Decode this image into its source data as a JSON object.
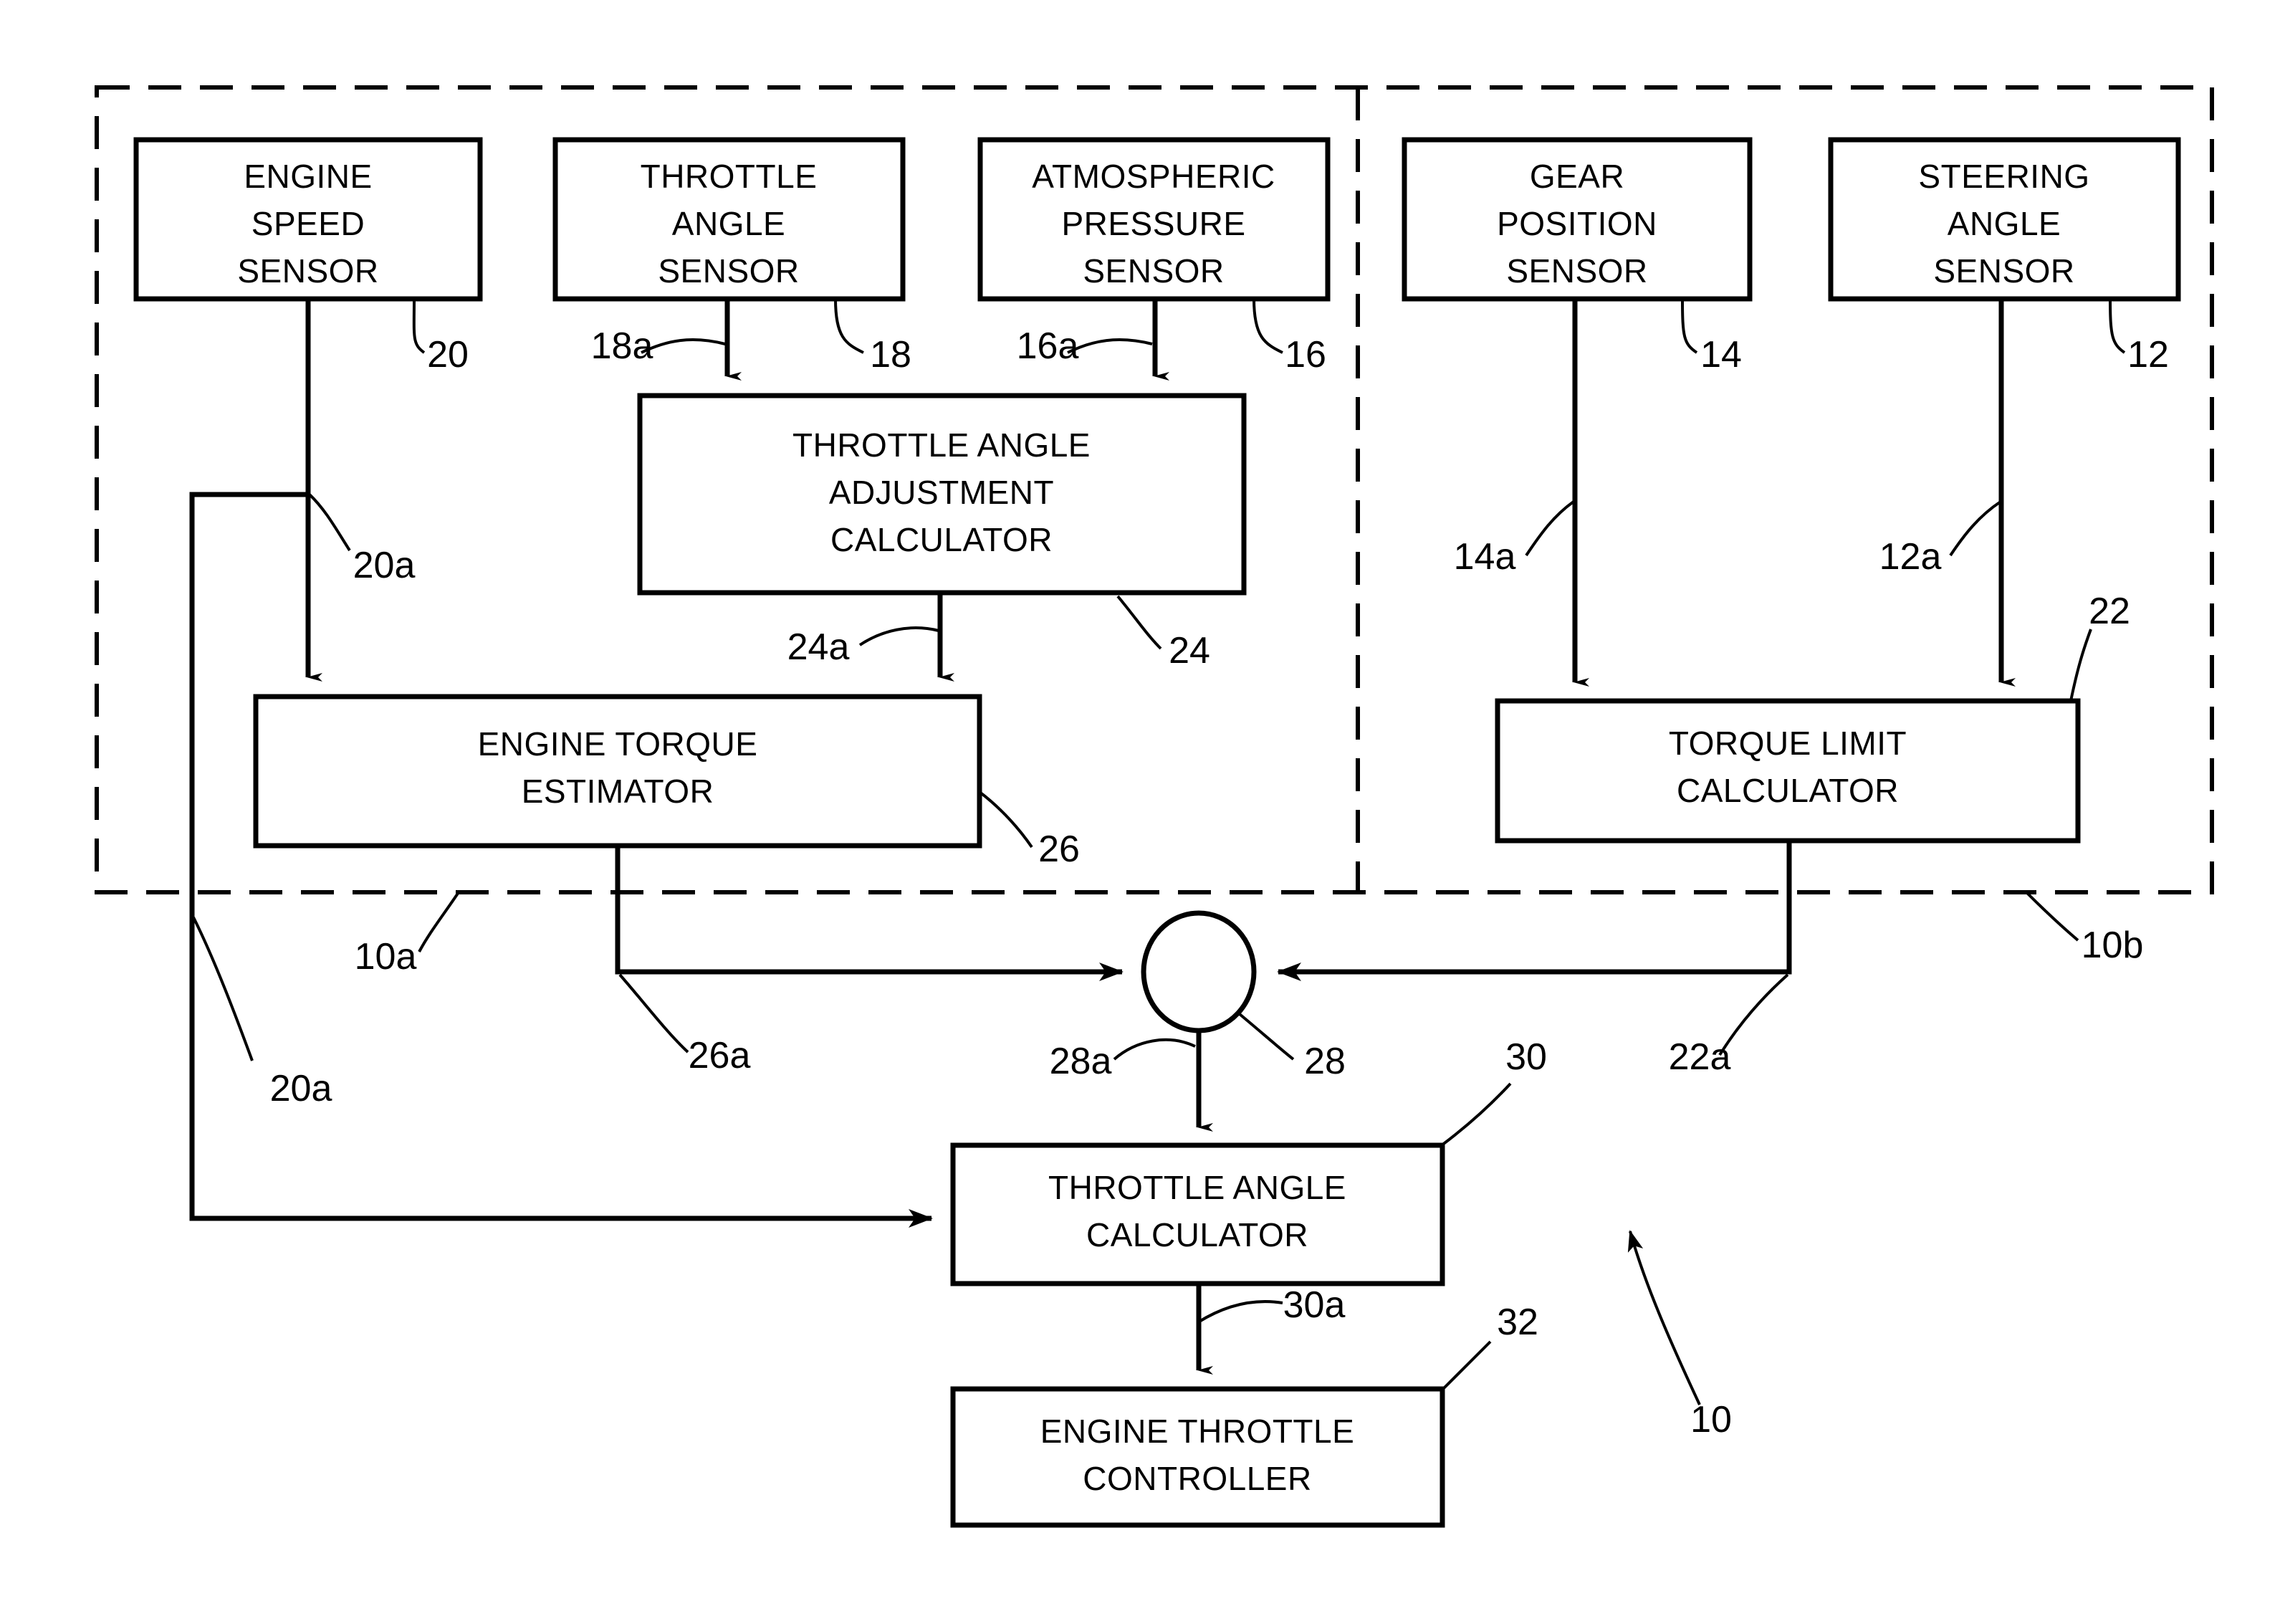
{
  "figure": {
    "type": "patent-block-diagram",
    "title": "Engine throttle control system block diagram",
    "system_reference": "10"
  },
  "blocks": [
    {
      "id": "engine-speed-sensor",
      "lines": [
        "ENGINE",
        "SPEED",
        "SENSOR"
      ],
      "ref": "20"
    },
    {
      "id": "throttle-angle-sensor",
      "lines": [
        "THROTTLE",
        "ANGLE",
        "SENSOR"
      ],
      "ref": "18"
    },
    {
      "id": "atmospheric-pressure-sensor",
      "lines": [
        "ATMOSPHERIC",
        "PRESSURE",
        "SENSOR"
      ],
      "ref": "16"
    },
    {
      "id": "gear-position-sensor",
      "lines": [
        "GEAR",
        "POSITION",
        "SENSOR"
      ],
      "ref": "14"
    },
    {
      "id": "steering-angle-sensor",
      "lines": [
        "STEERING",
        "ANGLE",
        "SENSOR"
      ],
      "ref": "12"
    },
    {
      "id": "throttle-angle-adjustment-calculator",
      "lines": [
        "THROTTLE ANGLE",
        "ADJUSTMENT",
        "CALCULATOR"
      ],
      "ref": "24"
    },
    {
      "id": "engine-torque-estimator",
      "lines": [
        "ENGINE TORQUE",
        "ESTIMATOR"
      ],
      "ref": "26"
    },
    {
      "id": "torque-limit-calculator",
      "lines": [
        "TORQUE LIMIT",
        "CALCULATOR"
      ],
      "ref": "22"
    },
    {
      "id": "throttle-angle-calculator",
      "lines": [
        "THROTTLE ANGLE",
        "CALCULATOR"
      ],
      "ref": "30"
    },
    {
      "id": "engine-throttle-controller",
      "lines": [
        "ENGINE THROTTLE",
        "CONTROLLER"
      ],
      "ref": "32"
    },
    {
      "id": "summing-junction",
      "lines": [],
      "ref": "28"
    }
  ],
  "block_text": {
    "engine_speed_sensor": {
      "l1": "ENGINE",
      "l2": "SPEED",
      "l3": "SENSOR"
    },
    "throttle_angle_sensor": {
      "l1": "THROTTLE",
      "l2": "ANGLE",
      "l3": "SENSOR"
    },
    "atmospheric_pressure_sensor": {
      "l1": "ATMOSPHERIC",
      "l2": "PRESSURE",
      "l3": "SENSOR"
    },
    "gear_position_sensor": {
      "l1": "GEAR",
      "l2": "POSITION",
      "l3": "SENSOR"
    },
    "steering_angle_sensor": {
      "l1": "STEERING",
      "l2": "ANGLE",
      "l3": "SENSOR"
    },
    "throttle_angle_adjustment_calculator": {
      "l1": "THROTTLE ANGLE",
      "l2": "ADJUSTMENT",
      "l3": "CALCULATOR"
    },
    "engine_torque_estimator": {
      "l1": "ENGINE TORQUE",
      "l2": "ESTIMATOR"
    },
    "torque_limit_calculator": {
      "l1": "TORQUE LIMIT",
      "l2": "CALCULATOR"
    },
    "throttle_angle_calculator": {
      "l1": "THROTTLE ANGLE",
      "l2": "CALCULATOR"
    },
    "engine_throttle_controller": {
      "l1": "ENGINE THROTTLE",
      "l2": "CONTROLLER"
    }
  },
  "reference_numerals": {
    "ref_20": "20",
    "ref_18a": "18a",
    "ref_18": "18",
    "ref_16a": "16a",
    "ref_16": "16",
    "ref_14": "14",
    "ref_12": "12",
    "ref_20a_upper": "20a",
    "ref_20a_lower": "20a",
    "ref_14a": "14a",
    "ref_12a": "12a",
    "ref_22": "22",
    "ref_24a": "24a",
    "ref_24": "24",
    "ref_26": "26",
    "ref_10a": "10a",
    "ref_26a": "26a",
    "ref_28a": "28a",
    "ref_28": "28",
    "ref_30": "30",
    "ref_22a": "22a",
    "ref_10b": "10b",
    "ref_30a": "30a",
    "ref_32": "32",
    "ref_10": "10"
  },
  "colors": {
    "ink": "#000000",
    "paper": "#ffffff"
  }
}
